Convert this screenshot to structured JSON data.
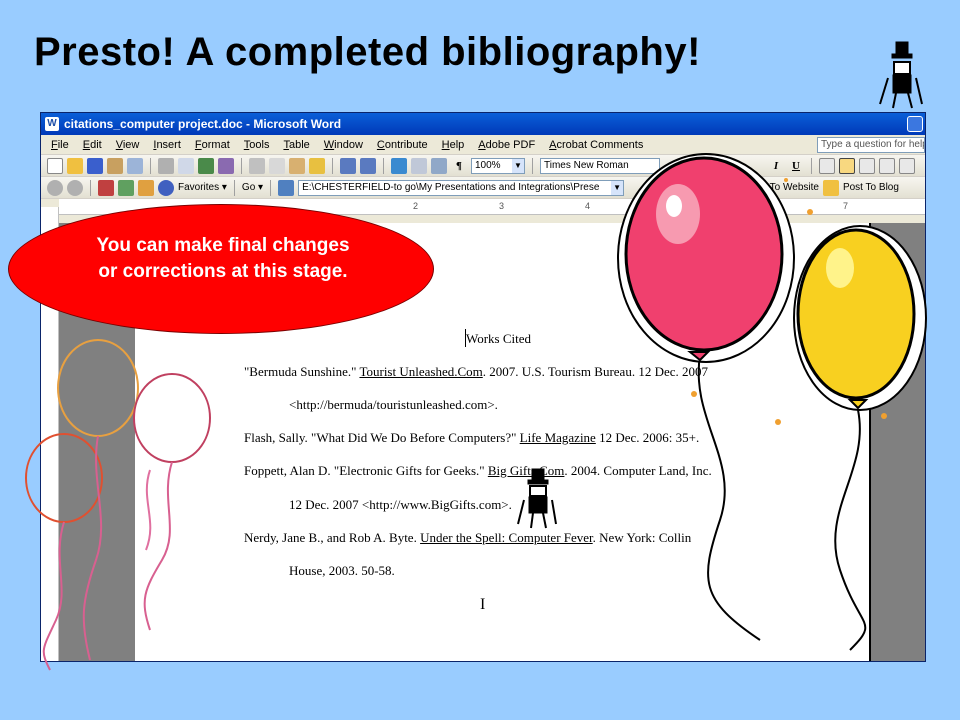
{
  "slide": {
    "title": "Presto! A completed bibliography!",
    "callout": "You can make final changes or corrections at this stage."
  },
  "window": {
    "title": "citations_computer project.doc - Microsoft Word",
    "app_icon": "W"
  },
  "menus": [
    "File",
    "Edit",
    "View",
    "Insert",
    "Format",
    "Tools",
    "Table",
    "Window",
    "Contribute",
    "Help",
    "Adobe PDF",
    "Acrobat Comments"
  ],
  "ask_placeholder": "Type a question for help",
  "toolbar": {
    "zoom": "100%",
    "font": "Times New Roman",
    "italic": "I",
    "underline": "U",
    "pilcrow": "¶"
  },
  "web_toolbar": {
    "favorites": "Favorites ▾",
    "go": "Go ▾",
    "address": "E:\\CHESTERFIELD-to go\\My Presentations and Integrations\\Prese",
    "publish": "lish To Website",
    "post": "Post To Blog"
  },
  "ruler": {
    "marks": [
      "2",
      "3",
      "4",
      "7"
    ]
  },
  "document": {
    "heading": "Works Cited",
    "entries": [
      {
        "before": "\"Bermuda Sunshine.\" ",
        "title": "Tourist Unleashed.Com",
        "after": ". 2007. U.S. Tourism Bureau. 12 Dec. 2007"
      },
      {
        "before": "<http://bermuda/touristunleashed.com>.",
        "title": "",
        "after": ""
      },
      {
        "before": "Flash, Sally. \"What Did We Do Before Computers?\" ",
        "title": "Life Magazine",
        "after": " 12 Dec. 2006: 35+."
      },
      {
        "before": "Foppett, Alan D. \"Electronic Gifts for Geeks.\" ",
        "title": "Big Gifts.Com",
        "after": ". 2004. Computer Land, Inc."
      },
      {
        "before": "12 Dec. 2007 <http://www.BigGifts.com>.",
        "title": "",
        "after": ""
      },
      {
        "before": "Nerdy, Jane B., and Rob A. Byte. ",
        "title": "Under the Spell: Computer Fever",
        "after": ". New York: Collin"
      },
      {
        "before": "House, 2003. 50-58.",
        "title": "",
        "after": ""
      }
    ],
    "ibeam": "I"
  },
  "colors": {
    "background": "#99ccff",
    "callout": "#ff0000",
    "balloon_pink": "#f0406e",
    "balloon_yellow": "#f8d020"
  }
}
